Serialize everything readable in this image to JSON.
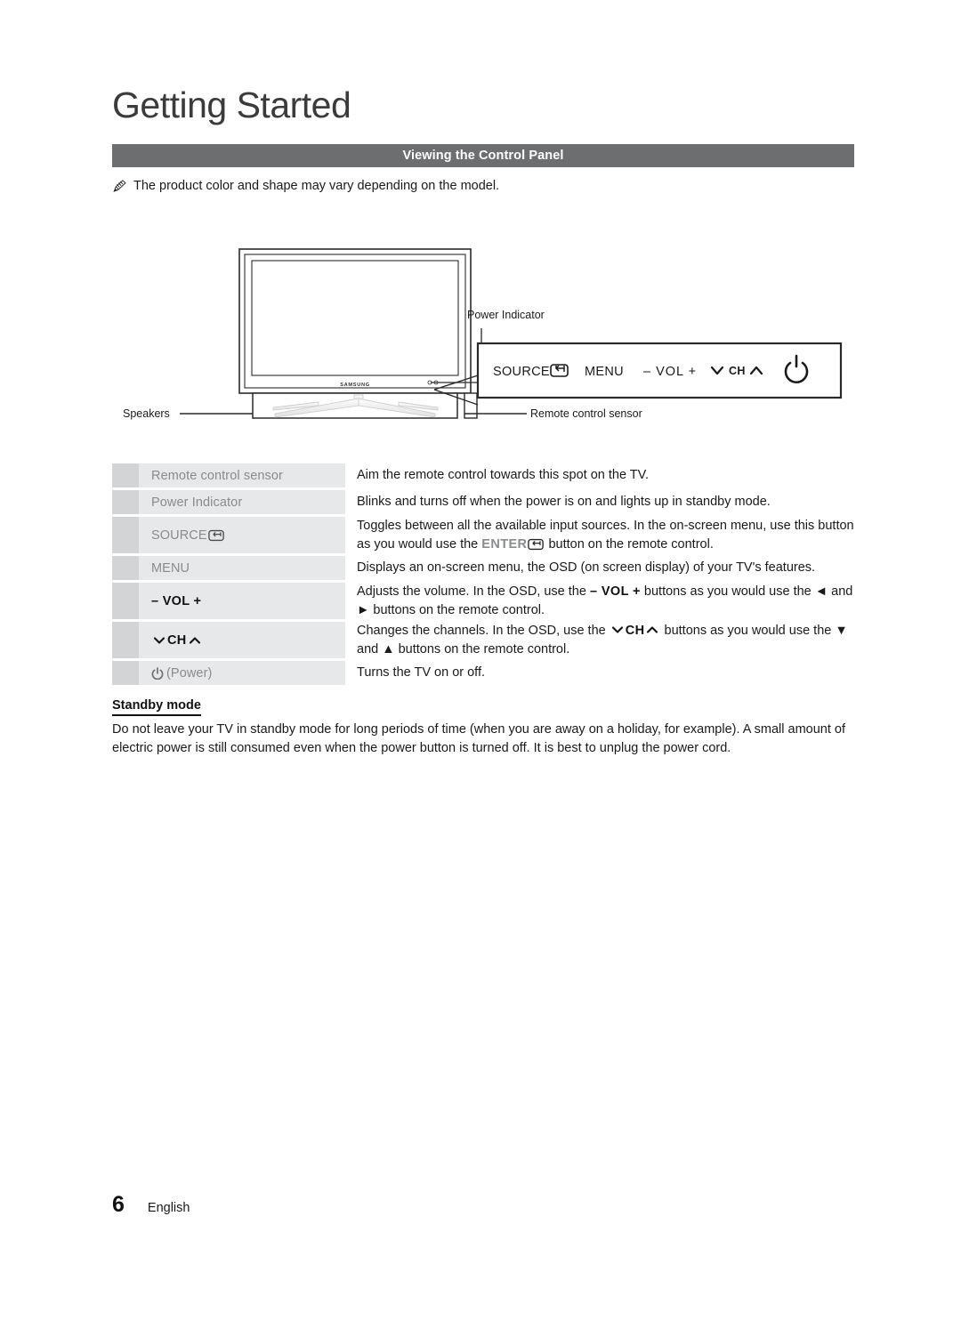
{
  "document": {
    "chapter_title": "Getting Started",
    "section_title": "Viewing the Control Panel",
    "note": "The product color and shape may vary depending on the model.",
    "note_icon": "pencil-icon"
  },
  "figure": {
    "brand_logo": "SAMSUNG",
    "callouts": {
      "power_indicator": "Power Indicator",
      "speakers": "Speakers",
      "remote_control_sensor": "Remote control sensor"
    },
    "control_panel_buttons": [
      {
        "label": "SOURCE",
        "icon": "enter-icon"
      },
      {
        "label": "MENU",
        "icon": ""
      },
      {
        "label": "– VOL +",
        "icon": ""
      },
      {
        "label": "CH",
        "icon": "chevron-down-up-icon"
      },
      {
        "label": "",
        "icon": "power-icon"
      }
    ]
  },
  "spec_table": {
    "rows": [
      {
        "label": "Remote control sensor",
        "label_style": "normal",
        "icon": "",
        "description": "Aim the remote control towards this spot on the TV.",
        "lines": 1
      },
      {
        "label": "Power Indicator",
        "label_style": "normal",
        "icon": "",
        "description": "Blinks and turns off when the power is on and lights up in standby mode.",
        "lines": 1
      },
      {
        "label": "SOURCE",
        "label_style": "normal",
        "icon": "enter-icon",
        "description_part1": "Toggles between all the available input sources. In the on-screen menu, use this button as you would use the ",
        "description_keyword": "ENTER",
        "description_part2": " button on the remote control.",
        "lines": 2
      },
      {
        "label": "MENU",
        "label_style": "normal",
        "icon": "",
        "description": "Displays an on-screen menu, the OSD (on screen display) of your TV's features.",
        "lines": 1
      },
      {
        "label": "– VOL +",
        "label_style": "bold",
        "icon": "",
        "description_part1": "Adjusts the volume. In the OSD, use the ",
        "description_keyword": "– VOL +",
        "description_part2": " buttons as you would use the ◄ and ► buttons on the remote control.",
        "lines": 2
      },
      {
        "label": "CH",
        "label_style": "bold",
        "icon": "chevron-down-up-icon",
        "description_part1": "Changes the channels. In the OSD, use the ",
        "description_keyword": "CH",
        "description_part2": " buttons as you would use the ▼ and ▲ buttons on the remote control.",
        "lines": 2
      },
      {
        "label": "(Power)",
        "label_style": "normal",
        "icon": "power-icon",
        "description": "Turns the TV on or off.",
        "lines": 1
      }
    ]
  },
  "standby": {
    "heading": "Standby mode",
    "body": "Do not leave your TV in standby mode for long periods of time (when you are away on a holiday, for example). A small amount of electric power is still consumed even when the power button is turned off. It is best to unplug the power cord."
  },
  "footer": {
    "page_number": "6",
    "language": "English"
  },
  "colors": {
    "section_bar": "#6d6e70",
    "marker_cell": "#d3d4d6",
    "label_cell": "#e7e8ea",
    "label_text": "#8a8b8d",
    "body_text": "#1a1a1a"
  }
}
